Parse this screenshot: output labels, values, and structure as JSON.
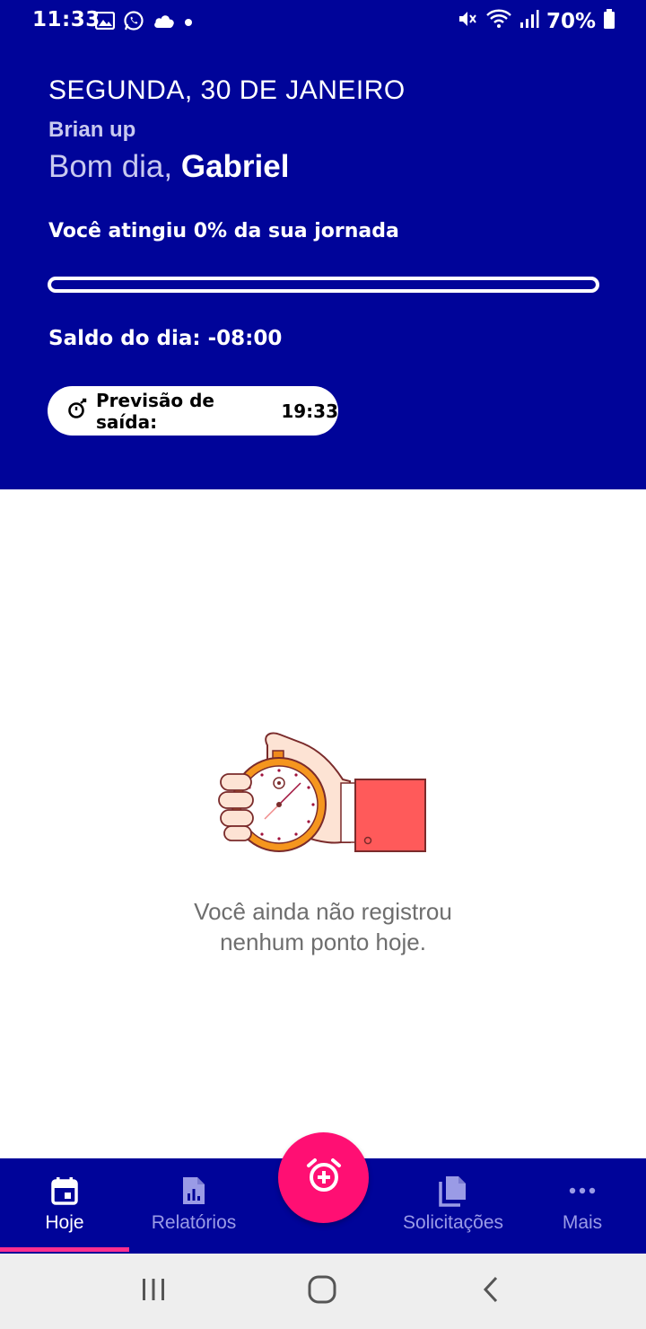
{
  "status_bar": {
    "time": "11:33",
    "left_icons": [
      "gallery-icon",
      "whatsapp-icon",
      "cloud-icon",
      "dot-icon"
    ],
    "right_icons": [
      "mute-icon",
      "wifi-icon",
      "signal-icon",
      "battery-icon"
    ],
    "battery": "70%"
  },
  "header": {
    "date": "SEGUNDA, 30 DE JANEIRO",
    "company": "Brian up",
    "greeting_prefix": "Bom dia,",
    "user_name": "Gabriel",
    "journey_text": "Você atingiu 0% da sua jornada",
    "journey_progress": 0,
    "balance_text": "Saldo do dia: -08:00",
    "exit_forecast_label": "Previsão de saída:",
    "exit_forecast_time": "19:33",
    "exit_icon": "stopwatch-icon"
  },
  "empty_state": {
    "illustration": "hand-stopwatch-illustration",
    "line1": "Você ainda não registrou",
    "line2": "nenhum ponto hoje."
  },
  "bottom_nav": {
    "items": [
      {
        "label": "Hoje",
        "icon": "calendar-icon",
        "active": true
      },
      {
        "label": "Relatórios",
        "icon": "report-icon",
        "active": false
      },
      {
        "label": "Solicitações",
        "icon": "documents-icon",
        "active": false
      },
      {
        "label": "Mais",
        "icon": "more-icon",
        "active": false
      }
    ],
    "fab_icon": "alarm-add-icon"
  },
  "colors": {
    "primary": "#000499",
    "accent": "#ff0f73",
    "indicator": "#ff2f8e",
    "muted_text": "#6e6e6e"
  }
}
